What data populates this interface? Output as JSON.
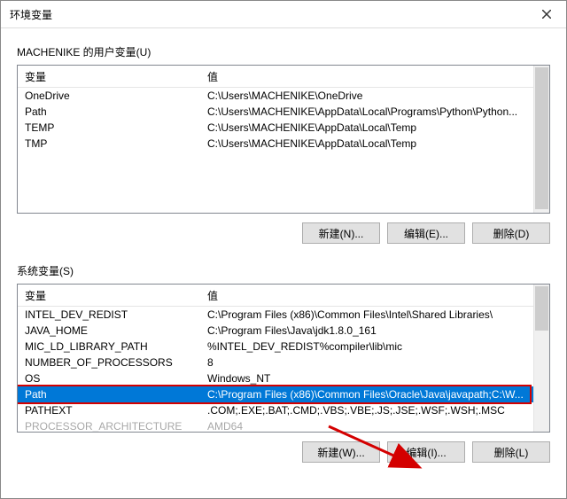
{
  "window": {
    "title": "环境变量"
  },
  "user_section": {
    "label": "MACHENIKE 的用户变量(U)",
    "headers": {
      "name": "变量",
      "value": "值"
    },
    "rows": [
      {
        "name": "OneDrive",
        "value": "C:\\Users\\MACHENIKE\\OneDrive"
      },
      {
        "name": "Path",
        "value": "C:\\Users\\MACHENIKE\\AppData\\Local\\Programs\\Python\\Python..."
      },
      {
        "name": "TEMP",
        "value": "C:\\Users\\MACHENIKE\\AppData\\Local\\Temp"
      },
      {
        "name": "TMP",
        "value": "C:\\Users\\MACHENIKE\\AppData\\Local\\Temp"
      }
    ],
    "buttons": {
      "new": "新建(N)...",
      "edit": "编辑(E)...",
      "delete": "删除(D)"
    }
  },
  "system_section": {
    "label": "系统变量(S)",
    "headers": {
      "name": "变量",
      "value": "值"
    },
    "rows": [
      {
        "name": "INTEL_DEV_REDIST",
        "value": "C:\\Program Files (x86)\\Common Files\\Intel\\Shared Libraries\\"
      },
      {
        "name": "JAVA_HOME",
        "value": "C:\\Program Files\\Java\\jdk1.8.0_161"
      },
      {
        "name": "MIC_LD_LIBRARY_PATH",
        "value": "%INTEL_DEV_REDIST%compiler\\lib\\mic"
      },
      {
        "name": "NUMBER_OF_PROCESSORS",
        "value": "8"
      },
      {
        "name": "OS",
        "value": "Windows_NT"
      },
      {
        "name": "Path",
        "value": "C:\\Program Files (x86)\\Common Files\\Oracle\\Java\\javapath;C:\\W..."
      },
      {
        "name": "PATHEXT",
        "value": ".COM;.EXE;.BAT;.CMD;.VBS;.VBE;.JS;.JSE;.WSF;.WSH;.MSC"
      },
      {
        "name": "PROCESSOR_ARCHITECTURE",
        "value": "AMD64"
      }
    ],
    "buttons": {
      "new": "新建(W)...",
      "edit": "编辑(I)...",
      "delete": "删除(L)"
    }
  }
}
